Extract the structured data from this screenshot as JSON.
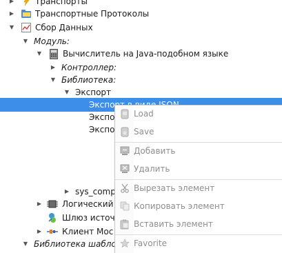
{
  "tree": {
    "items": [
      {
        "label": "Транспорты"
      },
      {
        "label": "Транспортные Протоколы"
      },
      {
        "label": "Сбор Данных"
      },
      {
        "label": "Модуль:"
      },
      {
        "label": "Вычислитель на Java-подобном языке"
      },
      {
        "label": "Контроллер:"
      },
      {
        "label": "Библиотека:"
      },
      {
        "label": "Экспорт"
      },
      {
        "label": "Экспорт в виде JSON"
      },
      {
        "label": "Экспо"
      },
      {
        "label": "Экспо"
      },
      {
        "label": "sys_comp"
      },
      {
        "label": "Логический"
      },
      {
        "label": "Шлюз источ"
      },
      {
        "label": "Клиент Мос"
      },
      {
        "label": "Библиотека шабло"
      }
    ]
  },
  "context_menu": {
    "items": [
      {
        "label": "Load",
        "icon": "load-icon"
      },
      {
        "label": "Save",
        "icon": "save-icon"
      },
      {
        "label": "Добавить",
        "icon": "add-icon"
      },
      {
        "label": "Удалить",
        "icon": "delete-icon"
      },
      {
        "label": "Вырезать элемент",
        "icon": "cut-icon"
      },
      {
        "label": "Копировать элемент",
        "icon": "copy-icon"
      },
      {
        "label": "Вставить элемент",
        "icon": "paste-icon"
      },
      {
        "label": "Favorite",
        "icon": "star-icon"
      }
    ]
  },
  "colors": {
    "selection": "#3d8ee6",
    "disabled_text": "#8e8e8e"
  }
}
